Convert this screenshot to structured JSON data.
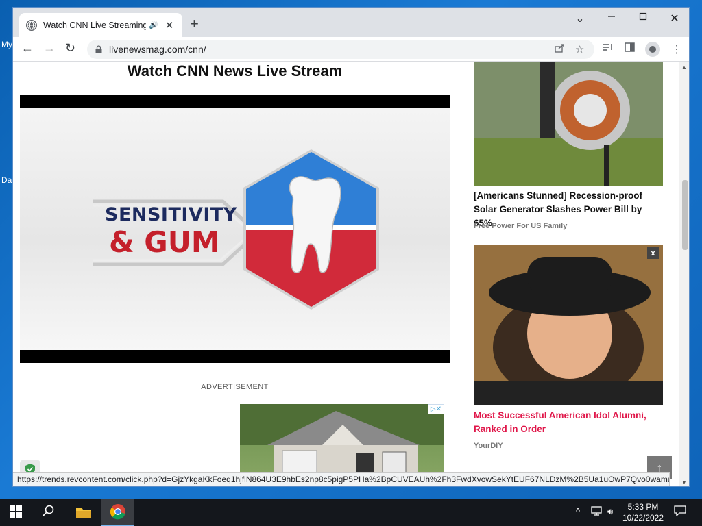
{
  "desktop": {
    "labels": [
      "My",
      "Da"
    ]
  },
  "browser": {
    "tab": {
      "title": "Watch CNN Live Streaming - ",
      "audio_icon": "🔊",
      "close": "✕"
    },
    "new_tab": "+",
    "window_controls": {
      "minimize": "⌄",
      "restore": "☐",
      "close": "✕",
      "chevron": "⌄"
    },
    "nav": {
      "back": "←",
      "forward": "→",
      "reload": "↻"
    },
    "url": "livenewsmag.com/cnn/",
    "status_url": "https://trends.revcontent.com/click.php?d=GjzYkgaKkFoeq1hjfiN864U3E9hbEs2np8c5pigP5PHa%2BpCUVEAUh%2Fh3FwdXvowSekYtEUF67NLDzM%2B5Ua1uOwP7Qvo0wamuoR..."
  },
  "page": {
    "title": "Watch CNN News Live Stream",
    "video_ad": {
      "line1": "SENSITIVITY",
      "line2": "& GUM"
    },
    "advertisement_label": "ADVERTISEMENT",
    "adchoices": "▷✕"
  },
  "sidebar": {
    "cards": [
      {
        "title": "[Americans Stunned] Recession-proof Solar Generator Slashes Power Bill by 65%",
        "source": "Free Power For US Family",
        "style": "dark"
      },
      {
        "title": "Most Successful American Idol Alumni, Ranked in Order",
        "source": "YourDIY",
        "style": "red",
        "close": "x"
      }
    ]
  },
  "back_to_top": "↑",
  "taskbar": {
    "time": "5:33 PM",
    "date": "10/22/2022",
    "tray_chevron": "^"
  },
  "colors": {
    "accent_red": "#e0174a",
    "navy": "#1c2a5e",
    "ad_red": "#c4202b"
  }
}
